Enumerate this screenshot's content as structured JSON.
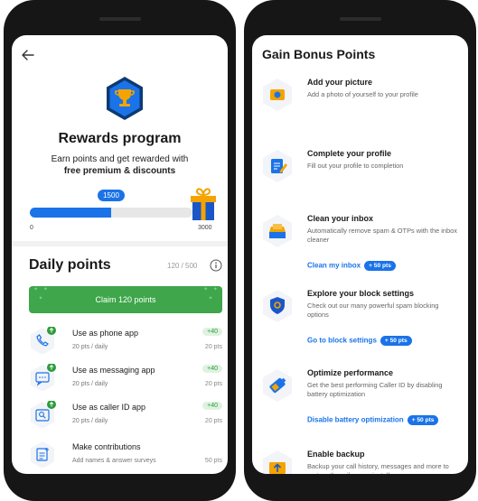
{
  "left_screen": {
    "back_icon": "arrow-left-icon",
    "badge_icon": "trophy-icon",
    "title": "Rewards program",
    "subtitle_line1": "Earn points and get rewarded with",
    "subtitle_line2": "free premium & discounts",
    "progress": {
      "current_label": "1500",
      "current": 1500,
      "min_label": "0",
      "max_label": "3000",
      "max": 3000
    },
    "gift_icon": "gift-icon",
    "daily": {
      "title": "Daily points",
      "count": "120 / 500",
      "info_icon": "info-icon",
      "claim_label": "Claim 120 points",
      "rows": [
        {
          "icon": "phone-icon",
          "title": "Use as phone app",
          "sub": "20 pts / daily",
          "pill": "+40",
          "pts": "20 pts"
        },
        {
          "icon": "message-icon",
          "title": "Use as messaging app",
          "sub": "20 pts / daily",
          "pill": "+40",
          "pts": "20 pts"
        },
        {
          "icon": "caller-id-icon",
          "title": "Use as caller ID app",
          "sub": "20 pts / daily",
          "pill": "+40",
          "pts": "20 pts"
        },
        {
          "icon": "contribution-icon",
          "title": "Make contributions",
          "sub": "Add names & answer surveys",
          "pill": "",
          "pts": "50 pts"
        }
      ]
    }
  },
  "right_screen": {
    "title": "Gain Bonus Points",
    "items": [
      {
        "icon": "camera-icon",
        "title": "Add your picture",
        "desc": "Add a photo of yourself to your profile",
        "action": "",
        "pill": ""
      },
      {
        "icon": "edit-profile-icon",
        "title": "Complete your profile",
        "desc": "Fill out your profile to completion",
        "action": "",
        "pill": ""
      },
      {
        "icon": "inbox-icon",
        "title": "Clean your inbox",
        "desc": "Automatically remove spam & OTPs with the inbox cleaner",
        "action": "Clean my inbox",
        "pill": "+ 50 pts"
      },
      {
        "icon": "shield-settings-icon",
        "title": "Explore your block settings",
        "desc": "Check out our many powerful spam blocking options",
        "action": "Go to block settings",
        "pill": "+ 50 pts"
      },
      {
        "icon": "battery-icon",
        "title": "Optimize performance",
        "desc": "Get the best performing Caller ID by disabling battery optimization",
        "action": "Disable battery optimization",
        "pill": "+ 50 pts"
      },
      {
        "icon": "backup-icon",
        "title": "Enable backup",
        "desc": "Backup your call history, messages and more to restore them if you re-install",
        "action": "",
        "pill": ""
      }
    ]
  },
  "colors": {
    "accent": "#1a73e8",
    "claim_green": "#3fa64b",
    "pill_green_bg": "#dff2e1",
    "pill_green_text": "#2e9b3c",
    "phone_body": "#161616"
  }
}
